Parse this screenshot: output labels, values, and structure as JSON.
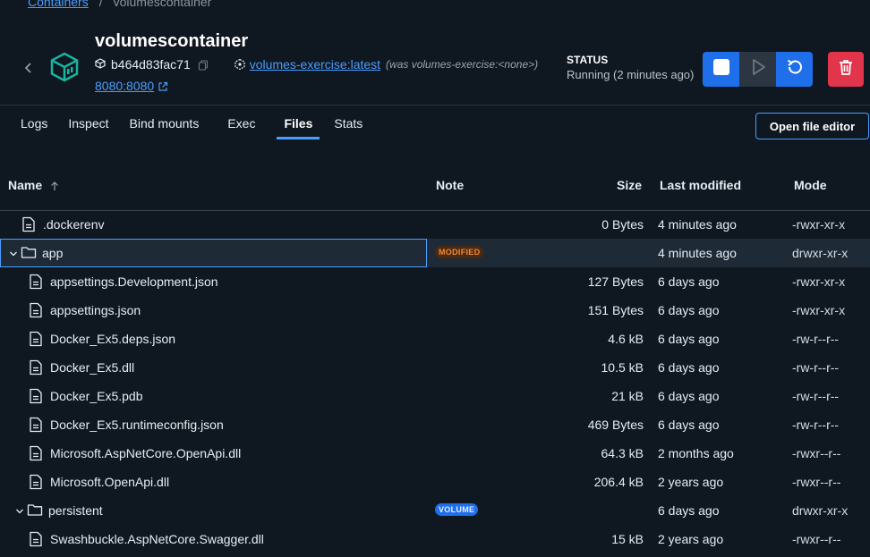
{
  "breadcrumb": {
    "link": "Containers",
    "separator": "/",
    "current": "volumescontainer"
  },
  "container": {
    "name": "volumescontainer",
    "id_short": "b464d83fac71",
    "image_link": "volumes-exercise:latest",
    "image_was": "(was volumes-exercise:<none>)",
    "port": "8080:8080"
  },
  "status": {
    "label": "STATUS",
    "value": "Running (2 minutes ago)"
  },
  "tabs": [
    {
      "label": "Logs"
    },
    {
      "label": "Inspect"
    },
    {
      "label": "Bind mounts"
    },
    {
      "label": "Exec"
    },
    {
      "label": "Files",
      "active": true
    },
    {
      "label": "Stats"
    }
  ],
  "open_editor_label": "Open file editor",
  "table": {
    "columns": {
      "name": "Name",
      "note": "Note",
      "size": "Size",
      "modified": "Last modified",
      "mode": "Mode"
    },
    "rows": [
      {
        "name": ".dockerenv",
        "note": "",
        "size": "0 Bytes",
        "modified": "4 minutes ago",
        "mode": "-rwxr-xr-x",
        "type": "file",
        "depth": 0
      },
      {
        "name": "app",
        "note": "MODIFIED",
        "size": "",
        "modified": "4 minutes ago",
        "mode": "drwxr-xr-x",
        "type": "folder",
        "depth": 0,
        "expanded": true,
        "selected": true
      },
      {
        "name": "appsettings.Development.json",
        "note": "",
        "size": "127 Bytes",
        "modified": "6 days ago",
        "mode": "-rwxr-xr-x",
        "type": "file",
        "depth": 1
      },
      {
        "name": "appsettings.json",
        "note": "",
        "size": "151 Bytes",
        "modified": "6 days ago",
        "mode": "-rwxr-xr-x",
        "type": "file",
        "depth": 1
      },
      {
        "name": "Docker_Ex5.deps.json",
        "note": "",
        "size": "4.6 kB",
        "modified": "6 days ago",
        "mode": "-rw-r--r--",
        "type": "file",
        "depth": 1
      },
      {
        "name": "Docker_Ex5.dll",
        "note": "",
        "size": "10.5 kB",
        "modified": "6 days ago",
        "mode": "-rw-r--r--",
        "type": "file",
        "depth": 1
      },
      {
        "name": "Docker_Ex5.pdb",
        "note": "",
        "size": "21 kB",
        "modified": "6 days ago",
        "mode": "-rw-r--r--",
        "type": "file",
        "depth": 1
      },
      {
        "name": "Docker_Ex5.runtimeconfig.json",
        "note": "",
        "size": "469 Bytes",
        "modified": "6 days ago",
        "mode": "-rw-r--r--",
        "type": "file",
        "depth": 1
      },
      {
        "name": "Microsoft.AspNetCore.OpenApi.dll",
        "note": "",
        "size": "64.3 kB",
        "modified": "2 months ago",
        "mode": "-rwxr--r--",
        "type": "file",
        "depth": 1
      },
      {
        "name": "Microsoft.OpenApi.dll",
        "note": "",
        "size": "206.4 kB",
        "modified": "2 years ago",
        "mode": "-rwxr--r--",
        "type": "file",
        "depth": 1
      },
      {
        "name": "persistent",
        "note": "VOLUME",
        "size": "",
        "modified": "6 days ago",
        "mode": "drwxr-xr-x",
        "type": "folder",
        "depth": 1,
        "expanded": true
      },
      {
        "name": "Swashbuckle.AspNetCore.Swagger.dll",
        "note": "",
        "size": "15 kB",
        "modified": "2 years ago",
        "mode": "-rwxr--r--",
        "type": "file",
        "depth": 1
      }
    ]
  },
  "colors": {
    "accent": "#1f6feb",
    "danger": "#e0354b",
    "background": "#0f1720",
    "brand_teal": "#18b5a0"
  }
}
